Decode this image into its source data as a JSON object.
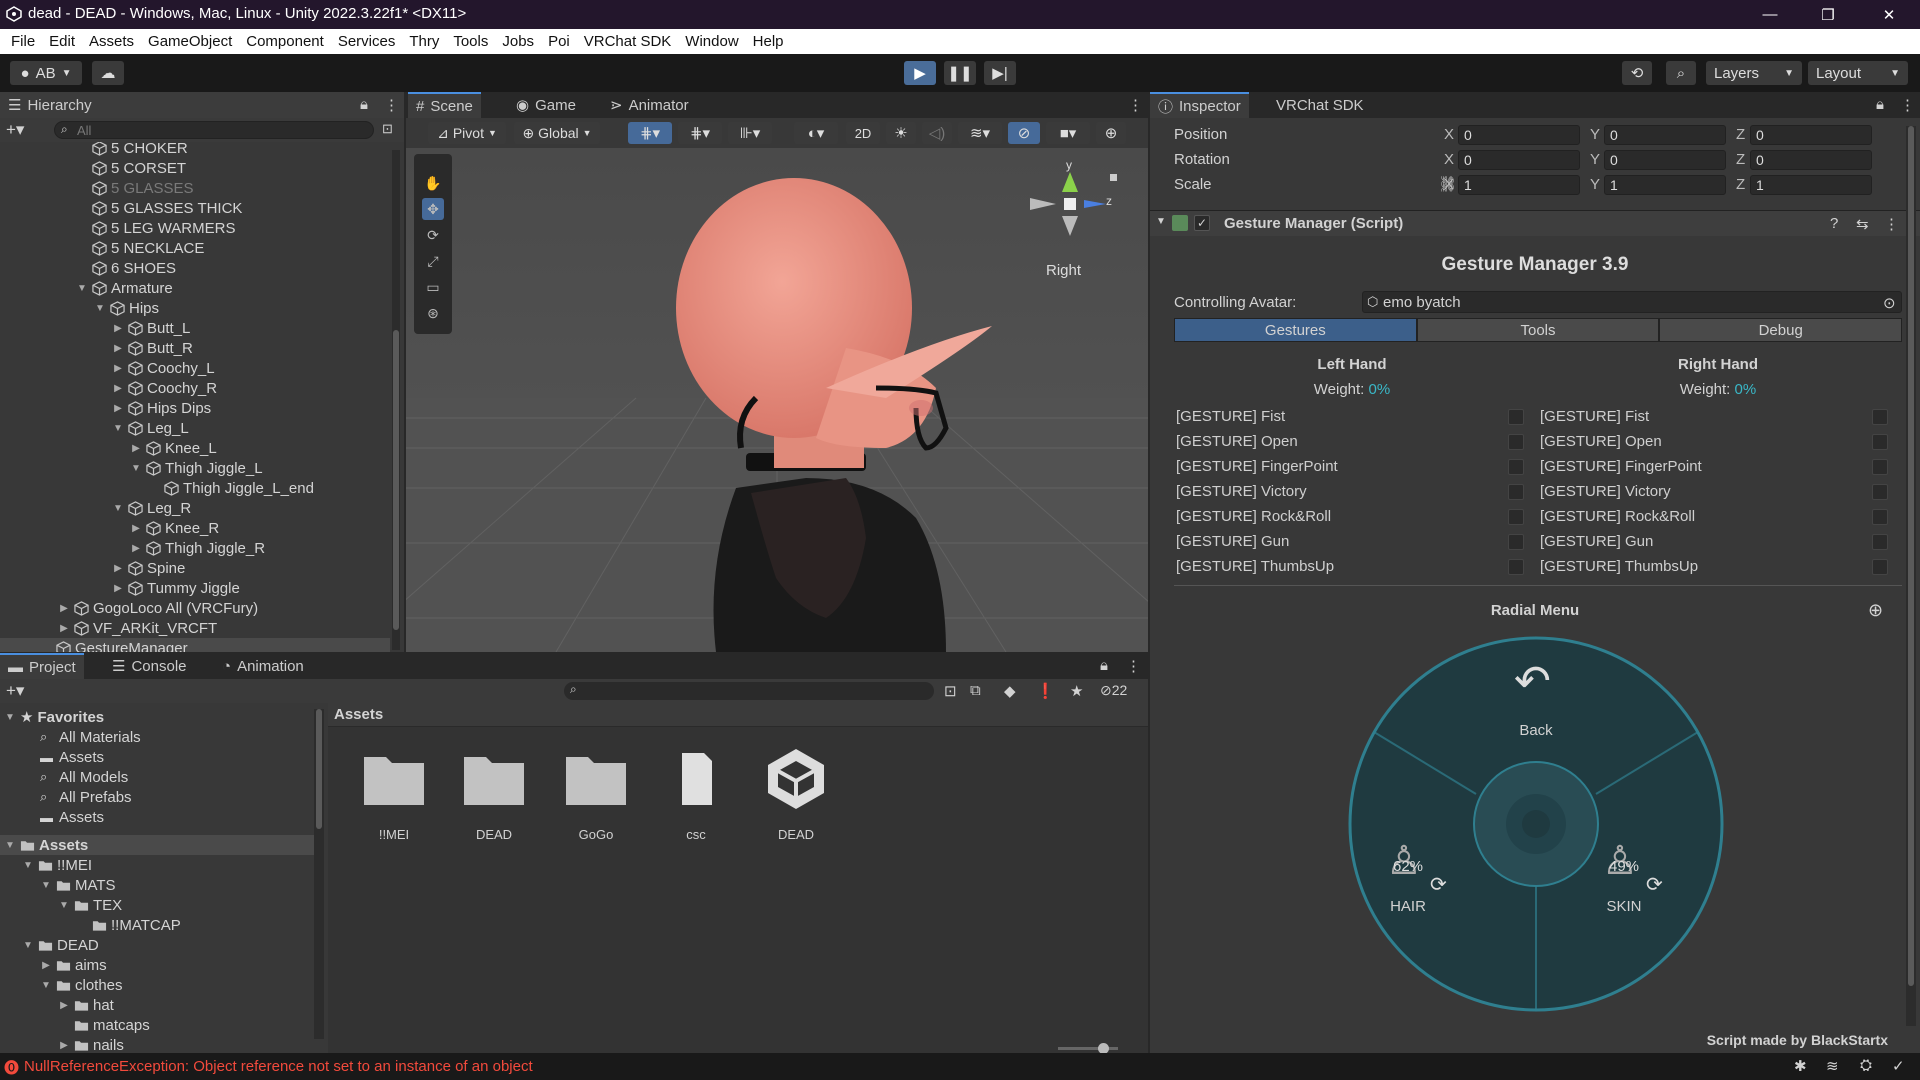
{
  "window": {
    "title": "dead - DEAD - Windows, Mac, Linux - Unity 2022.3.22f1* <DX11>",
    "minimize": "—",
    "maximize": "❐",
    "close": "✕"
  },
  "menu": [
    "File",
    "Edit",
    "Assets",
    "GameObject",
    "Component",
    "Services",
    "Thry",
    "Tools",
    "Jobs",
    "Poi",
    "VRChat SDK",
    "Window",
    "Help"
  ],
  "toolbar": {
    "account": "AB",
    "layers": "Layers",
    "layout": "Layout"
  },
  "hierarchy": {
    "tab": "Hierarchy",
    "search_placeholder": "All",
    "items": [
      {
        "label": "5 CHOKER",
        "indent": 0,
        "arrow": "",
        "dim": false
      },
      {
        "label": "5 CORSET",
        "indent": 0,
        "arrow": "",
        "dim": false
      },
      {
        "label": "5 GLASSES",
        "indent": 0,
        "arrow": "",
        "dim": true
      },
      {
        "label": "5 GLASSES THICK",
        "indent": 0,
        "arrow": "",
        "dim": false
      },
      {
        "label": "5 LEG WARMERS",
        "indent": 0,
        "arrow": "",
        "dim": false
      },
      {
        "label": "5 NECKLACE",
        "indent": 0,
        "arrow": "",
        "dim": false
      },
      {
        "label": "6 SHOES",
        "indent": 0,
        "arrow": "",
        "dim": false
      },
      {
        "label": "Armature",
        "indent": 0,
        "arrow": "down",
        "dim": false
      },
      {
        "label": "Hips",
        "indent": 1,
        "arrow": "down",
        "dim": false
      },
      {
        "label": "Butt_L",
        "indent": 2,
        "arrow": "right",
        "dim": false
      },
      {
        "label": "Butt_R",
        "indent": 2,
        "arrow": "right",
        "dim": false
      },
      {
        "label": "Coochy_L",
        "indent": 2,
        "arrow": "right",
        "dim": false
      },
      {
        "label": "Coochy_R",
        "indent": 2,
        "arrow": "right",
        "dim": false
      },
      {
        "label": "Hips Dips",
        "indent": 2,
        "arrow": "right",
        "dim": false
      },
      {
        "label": "Leg_L",
        "indent": 2,
        "arrow": "down",
        "dim": false
      },
      {
        "label": "Knee_L",
        "indent": 3,
        "arrow": "right",
        "dim": false
      },
      {
        "label": "Thigh Jiggle_L",
        "indent": 3,
        "arrow": "down",
        "dim": false
      },
      {
        "label": "Thigh Jiggle_L_end",
        "indent": 4,
        "arrow": "",
        "dim": false
      },
      {
        "label": "Leg_R",
        "indent": 2,
        "arrow": "down",
        "dim": false
      },
      {
        "label": "Knee_R",
        "indent": 3,
        "arrow": "right",
        "dim": false
      },
      {
        "label": "Thigh Jiggle_R",
        "indent": 3,
        "arrow": "right",
        "dim": false
      },
      {
        "label": "Spine",
        "indent": 2,
        "arrow": "right",
        "dim": false
      },
      {
        "label": "Tummy Jiggle",
        "indent": 2,
        "arrow": "right",
        "dim": false
      },
      {
        "label": "GogoLoco All (VRCFury)",
        "indent": -1,
        "arrow": "right",
        "dim": false
      },
      {
        "label": "VF_ARKit_VRCFT",
        "indent": -1,
        "arrow": "right",
        "dim": false
      },
      {
        "label": "GestureManager",
        "indent": -2,
        "arrow": "",
        "dim": false,
        "selected": true
      }
    ]
  },
  "scene": {
    "tabs": [
      "Scene",
      "Game",
      "Animator"
    ],
    "pivot": "Pivot",
    "global": "Global",
    "mode2d": "2D",
    "view_label": "Right",
    "axis_y": "y",
    "axis_z": "z"
  },
  "project": {
    "tabs": [
      "Project",
      "Console",
      "Animation"
    ],
    "hidden_count": "22",
    "breadcrumb": "Assets",
    "favorites_label": "Favorites",
    "favorites": [
      "All Materials",
      "Assets",
      "All Models",
      "All Prefabs",
      "Assets"
    ],
    "tree": [
      {
        "label": "Assets",
        "indent": 0,
        "arrow": "down",
        "selected": true
      },
      {
        "label": "!!MEI",
        "indent": 1,
        "arrow": "down"
      },
      {
        "label": "MATS",
        "indent": 2,
        "arrow": "down"
      },
      {
        "label": "TEX",
        "indent": 3,
        "arrow": "down"
      },
      {
        "label": "!!MATCAP",
        "indent": 4,
        "arrow": ""
      },
      {
        "label": "DEAD",
        "indent": 1,
        "arrow": "down"
      },
      {
        "label": "aims",
        "indent": 2,
        "arrow": "right"
      },
      {
        "label": "clothes",
        "indent": 2,
        "arrow": "down"
      },
      {
        "label": "hat",
        "indent": 3,
        "arrow": "right"
      },
      {
        "label": "matcaps",
        "indent": 3,
        "arrow": ""
      },
      {
        "label": "nails",
        "indent": 3,
        "arrow": "right"
      }
    ],
    "assets": [
      {
        "label": "!!MEI",
        "kind": "folder"
      },
      {
        "label": "DEAD",
        "kind": "folder"
      },
      {
        "label": "GoGo",
        "kind": "folder"
      },
      {
        "label": "csc",
        "kind": "file"
      },
      {
        "label": "DEAD",
        "kind": "unity"
      }
    ]
  },
  "inspector": {
    "tabs": [
      "Inspector",
      "VRChat SDK"
    ],
    "transform": {
      "position_label": "Position",
      "rotation_label": "Rotation",
      "scale_label": "Scale",
      "position": [
        "0",
        "0",
        "0"
      ],
      "rotation": [
        "0",
        "0",
        "0"
      ],
      "scale": [
        "1",
        "1",
        "1"
      ],
      "axes": [
        "X",
        "Y",
        "Z"
      ]
    },
    "component_title": "Gesture Manager (Script)",
    "gm_title": "Gesture Manager 3.9",
    "controlling_label": "Controlling Avatar:",
    "controlling_value": "emo byatch",
    "mode_tabs": [
      "Gestures",
      "Tools",
      "Debug"
    ],
    "left_title": "Left Hand",
    "right_title": "Right Hand",
    "weight_label": "Weight:",
    "left_weight": "0%",
    "right_weight": "0%",
    "gestures": [
      "[GESTURE] Fist",
      "[GESTURE] Open",
      "[GESTURE] FingerPoint",
      "[GESTURE] Victory",
      "[GESTURE] Rock&Roll",
      "[GESTURE] Gun",
      "[GESTURE] ThumbsUp"
    ],
    "radial_title": "Radial Menu",
    "radial": {
      "back": "Back",
      "hair_label": "HAIR",
      "hair_value": "62%",
      "skin_label": "SKIN",
      "skin_value": "49%"
    },
    "footer": "Script made by BlackStartx"
  },
  "status": {
    "error": "NullReferenceException: Object reference not set to an instance of an object"
  },
  "colors": {
    "accent": "#4a8fe0",
    "weight": "#3ab8c8",
    "error": "#f24a3c",
    "radial_bg": "#1f3a40",
    "radial_ring": "#2f7f8f"
  }
}
